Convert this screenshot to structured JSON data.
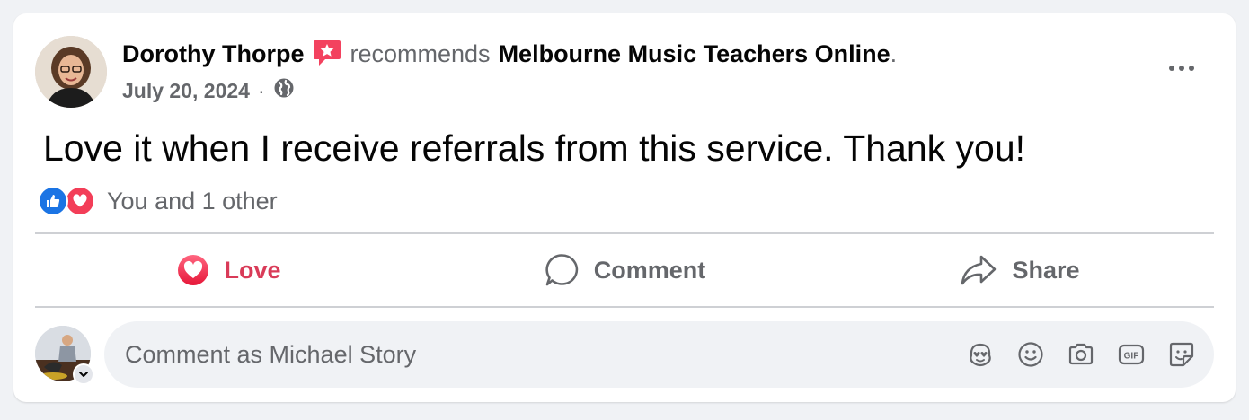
{
  "post": {
    "author": "Dorothy Thorpe",
    "recommends_word": "recommends",
    "page_name": "Melbourne Music Teachers Online",
    "period": ".",
    "date": "July 20, 2024",
    "separator": "·",
    "privacy_icon": "globe-icon",
    "text": "Love it when I receive referrals from this service. Thank you!"
  },
  "reactions": {
    "icons": [
      "like-icon",
      "heart-icon"
    ],
    "summary": "You and 1 other"
  },
  "actions": {
    "love_label": "Love",
    "comment_label": "Comment",
    "share_label": "Share"
  },
  "composer": {
    "placeholder": "Comment as Michael Story",
    "tools": [
      "avatar-sticker-icon",
      "emoji-icon",
      "camera-icon",
      "gif-icon",
      "sticker-icon"
    ],
    "gif_text": "GIF"
  },
  "colors": {
    "love_active": "#d93b58",
    "like_blue": "#1b74e4",
    "heart_red": "#f33e58",
    "secondary_text": "#65676b",
    "background": "#f0f2f5"
  }
}
